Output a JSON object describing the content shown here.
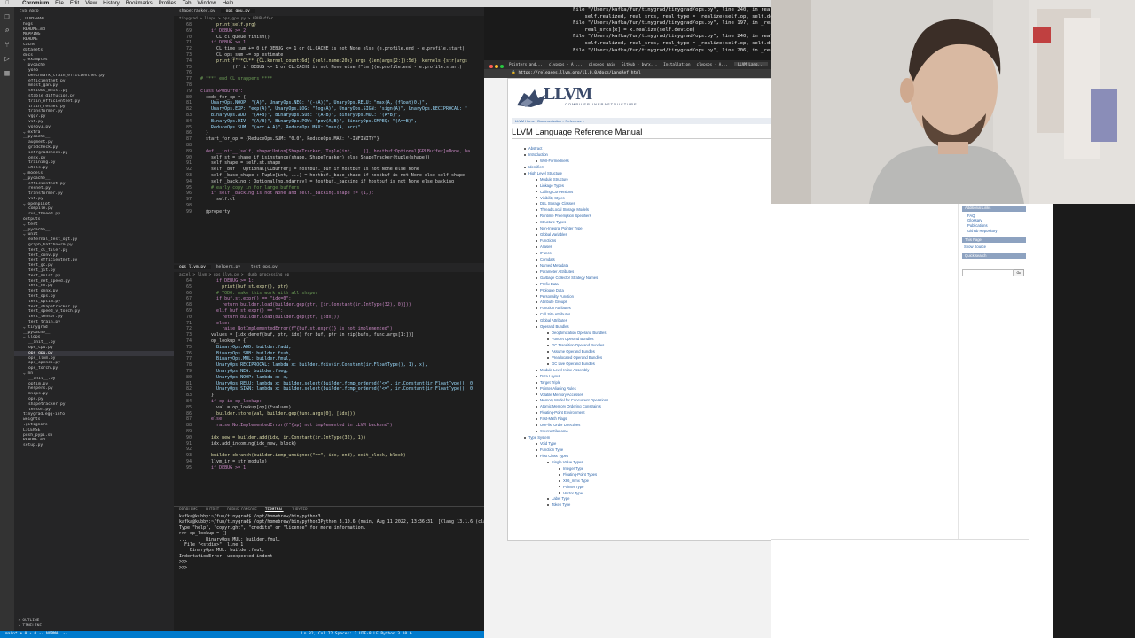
{
  "menubar": {
    "apple": "",
    "items": [
      "Chromium",
      "File",
      "Edit",
      "View",
      "History",
      "Bookmarks",
      "Profiles",
      "Tab",
      "Window",
      "Help"
    ],
    "clock": ""
  },
  "vscode": {
    "explorer_title": "EXPLORER",
    "tree": [
      "TINYGRAD",
      "hugs",
      "README.md",
      "MAPPING",
      "README",
      "cache",
      "datasets",
      "docs",
      "examples",
      "__pycache__",
      "yolo",
      "benchmark_train_efficientnet.py",
      "efficientnet.py",
      "mnist_gan.py",
      "serious_mnist.py",
      "stable_diffusion.py",
      "train_efficientnet.py",
      "train_resnet.py",
      "transformer.py",
      "vgg7.py",
      "vit.py",
      "yolov3.py",
      "extra",
      "__pycache__",
      "augment.py",
      "gradcheck.py",
      "intrgradcheck.py",
      "onnx.py",
      "training.py",
      "utils.py",
      "models",
      "__pycache__",
      "efficientnet.py",
      "resnet.py",
      "transformer.py",
      "vit.py",
      "openpilot",
      "compile.py",
      "run_thneed.py",
      "outputs",
      "test",
      "__pycache__",
      "unit",
      "external_test_opt.py",
      "graph_batchnorm.py",
      "test_cl_tiler.py",
      "test_conv.py",
      "test_efficientnet.py",
      "test_gc.py",
      "test_jit.py",
      "test_mnist.py",
      "test_net_speed.py",
      "test_nn.py",
      "test_onnx.py",
      "test_ops.py",
      "test_optim.py",
      "test_shapetracker.py",
      "test_speed_v_torch.py",
      "test_tensor.py",
      "test_train.py",
      "tinygrad",
      "__pycache__",
      "llops",
      "__init__.py",
      "ops_cpu.py",
      "ops_gpu.py",
      "ops_llvm.py",
      "ops_opencl.py",
      "ops_torch.py",
      "nn",
      "__init__.py",
      "optim.py",
      "helpers.py",
      "mlops.py",
      "ops.py",
      "shapetracker.py",
      "tensor.py",
      "tinygrad.egg-info",
      "weights",
      ".gitignore",
      "LICENSE",
      "push_pypi.sh",
      "README.md",
      "setup.py"
    ],
    "footer_items": [
      "OUTLINE",
      "TIMELINE"
    ],
    "editor1": {
      "tabs": [
        "shapetracker.py",
        "ops_gpu.py"
      ],
      "breadcrumb": "tinygrad > llops > ops_gpu.py > GPUBuffer",
      "first_line": 68,
      "lines": [
        "      print(self.prg)",
        "    if DEBUG >= 2:",
        "      CL.cl_queue.finish()",
        "    if DEBUG >= 1:",
        "      CL.time_sum += 0 if DEBUG <= 1 or CL.CACHE is not None else (e.profile.end - e.profile.start)",
        "      CL.ops_sum += op_estimate",
        "      print(f\"**CL** {CL.kernel_count:6d} {self.name:20s} args {len(args[2:]):5d}  kernels {str(args",
        "            (f\" if DEBUG <= 1 or CL.CACHE is not None else f\"tm {(e.profile.end - e.profile.start)",
        "",
        "# **** end CL wrappers ****",
        "",
        "class GPUBuffer:",
        "  code_for_op = {",
        "    UnaryOps.NOOP: \"(A)\", UnaryOps.NEG: \"(-(A))\", UnaryOps.RELU: \"max(A, (float)0.)\",",
        "    UnaryOps.EXP: \"exp(A)\", UnaryOps.LOG: \"log(A)\", UnaryOps.SIGN: \"sign(A)\", UnaryOps.RECIPROCAL: \"",
        "    BinaryOps.ADD: \"(A+B)\", BinaryOps.SUB: \"(A-B)\", BinaryOps.MUL: \"(A*B)\",",
        "    BinaryOps.DIV: \"(A/B)\", BinaryOps.POW: \"pow(A,B)\", BinaryOps.CMPEQ: \"(A==B)\",",
        "    ReduceOps.SUM: \"(acc + A)\", ReduceOps.MAX: \"max(A, acc)\"",
        "  }",
        "  start_for_op = {ReduceOps.SUM: \"0.0\", ReduceOps.MAX: \"-INFINITY\"}",
        "",
        "  def __init__(self, shape:Union[ShapeTracker, Tuple[int, ...]], hostbuf:Optional[GPUBuffer]=None, ba",
        "    self.st = shape if isinstance(shape, ShapeTracker) else ShapeTracker(tuple(shape))",
        "    self.shape = self.st.shape",
        "    self._buf : Optional[CLBuffer] = hostbuf._buf if hostbuf is not None else None",
        "    self._base_shape : Tuple[int, ...] = hostbuf._base_shape if hostbuf is not None else self.shape",
        "    self._backing : Optional[np.ndarray] = hostbuf._backing if hostbuf is not None else backing",
        "    # early copy in for large buffers",
        "    if self._backing is not None and self._backing.shape != (1,):",
        "      self.cl",
        "",
        "  @property"
      ]
    },
    "editor2": {
      "tabs": [
        "ops_llvm.py",
        "helpers.py",
        "test_ops.py"
      ],
      "breadcrumb": "accel > llvm > ops_llvm.py > _dumb_processing_op",
      "first_line": 64,
      "lines": [
        "      if DEBUG >= 1:",
        "        print(buf.st.expr(), ptr)",
        "      # TODO: make this work with all shapes",
        "      if buf.st.expr() == \"idx=0\":",
        "        return builder.load(builder.gep(ptr, [ir.Constant(ir.IntType(32), 0)]))",
        "      elif buf.st.expr() == \"\":",
        "        return builder.load(builder.gep(ptr, [idx]))",
        "      else:",
        "        raise NotImplementedError(f\"{buf.st.expr()} is not implemented\")",
        "    values = [idx_deref(buf, ptr, idx) for buf, ptr in zip(bufs, func.args[1:])]",
        "    op_lookup = {",
        "      BinaryOps.ADD: builder.fadd,",
        "      BinaryOps.SUB: builder.fsub,",
        "      BinaryOps.MUL: builder.fmul,",
        "      UnaryOps.RECIPROCAL: lambda x: builder.fdiv(ir.Constant(ir.FloatType(), 1), x),",
        "      UnaryOps.NEG: builder.fneg,",
        "      UnaryOps.NOOP: lambda x: x,",
        "      UnaryOps.RELU: lambda x: builder.select(builder.fcmp_ordered(\"<=\", ir.Constant(ir.FloatType(), 0",
        "      UnaryOps.SIGN: lambda x: builder.select(builder.fcmp_ordered(\"<=\", ir.Constant(ir.FloatType(), 0",
        "    }",
        "    if op in op_lookup:",
        "      val = op_lookup[op](*values)",
        "      builder.store(val, builder.gep(func.args[0], [idx]))",
        "    else:",
        "      raise NotImplementedError(f\"{op} not implemented in LLVM backend\")",
        "",
        "    idx_new = builder.add(idx, ir.Constant(ir.IntType(32), 1))",
        "    idx.add_incoming(idx_new, block)",
        "",
        "    builder.cbranch(builder.icmp_unsigned(\"==\", idx, end), exit_block, block)",
        "    llvm_ir = str(module)",
        "    if DEBUG >= 1:"
      ]
    },
    "terminal": {
      "panel_tabs": [
        "PROBLEMS",
        "OUTPUT",
        "DEBUG CONSOLE",
        "TERMINAL",
        "JUPYTER"
      ],
      "active_tab": "TERMINAL",
      "lines": [
        "kafka@kubby:~/fun/tinygrad$ /opt/homebrew/bin/python3",
        "kafka@kubby:~/fun/tinygrad$ /opt/homebrew/bin/python3Python 3.10.6 (main, Aug 11 2022, 13:36:31) [Clang 13.1.6 (clang-",
        "Type \"help\", \"copyright\", \"credits\" or \"license\" for more information.",
        ">>> op_lookup = {}",
        "...       BinaryOps.MUL: builder.fmul,",
        "  File \"<stdin>\", line 1",
        "    BinaryOps.MUL: builder.fmul,",
        "IndentationError: unexpected indent",
        ">>>",
        ">>>"
      ]
    },
    "status": {
      "left": "main*  ⊗ 0 ⚠ 0  -- NORMAL --",
      "right": "Ln 82, Col 72   Spaces: 2   UTF-8   LF   Python   3.10.6"
    }
  },
  "terminal_errors": [
    "File \"/Users/kafka/fun/tinygrad/tinygrad/ops.py\", line 240, in real",
    "    self.realized, real_srcs, real_type = _realize(self.op, self.device",
    "File \"/Users/kafka/fun/tinygrad/tinygrad/ops.py\", line 197, in _rea",
    "    real_srcs[x] = x.realize(self.device)",
    "File \"/Users/kafka/fun/tinygrad/tinygrad/ops.py\", line 240, in real",
    "    self.realized, real_srcs, real_type = _realize(self.op, self.devi",
    "File \"/Users/kafka/fun/tinygrad/tinygrad/ops.py\", line 206, in _rea"
  ],
  "browser": {
    "tabs": [
      "Pointers and...",
      "clypsos - A ...",
      "clypsos_main",
      "GitHub - byrx...",
      "Installation",
      "clypsos - A...",
      "LLVM Lang..."
    ],
    "url": "https://releases.llvm.org/11.0.0/docs/LangRef.html",
    "logo_text": "LLVM",
    "logo_sub": "COMPILER INFRASTRUCTURE",
    "nav": "LLVM Home  |  Documentation » Reference »",
    "doc_title": "LLVM Language Reference Manual",
    "toc": [
      {
        "t": "Abstract",
        "l": 0
      },
      {
        "t": "Introduction",
        "l": 0
      },
      {
        "t": "Well-Formedness",
        "l": 1
      },
      {
        "t": "Identifiers",
        "l": 0
      },
      {
        "t": "High Level Structure",
        "l": 0
      },
      {
        "t": "Module Structure",
        "l": 1
      },
      {
        "t": "Linkage Types",
        "l": 1
      },
      {
        "t": "Calling Conventions",
        "l": 1
      },
      {
        "t": "Visibility Styles",
        "l": 1
      },
      {
        "t": "DLL Storage Classes",
        "l": 1
      },
      {
        "t": "Thread Local Storage Models",
        "l": 1
      },
      {
        "t": "Runtime Preemption Specifiers",
        "l": 1
      },
      {
        "t": "Structure Types",
        "l": 1
      },
      {
        "t": "Non-Integral Pointer Type",
        "l": 1
      },
      {
        "t": "Global Variables",
        "l": 1
      },
      {
        "t": "Functions",
        "l": 1
      },
      {
        "t": "Aliases",
        "l": 1
      },
      {
        "t": "IFuncs",
        "l": 1
      },
      {
        "t": "Comdats",
        "l": 1
      },
      {
        "t": "Named Metadata",
        "l": 1
      },
      {
        "t": "Parameter Attributes",
        "l": 1
      },
      {
        "t": "Garbage Collector Strategy Names",
        "l": 1
      },
      {
        "t": "Prefix Data",
        "l": 1
      },
      {
        "t": "Prologue Data",
        "l": 1
      },
      {
        "t": "Personality Function",
        "l": 1
      },
      {
        "t": "Attribute Groups",
        "l": 1
      },
      {
        "t": "Function Attributes",
        "l": 1
      },
      {
        "t": "Call Site Attributes",
        "l": 1
      },
      {
        "t": "Global Attributes",
        "l": 1
      },
      {
        "t": "Operand Bundles",
        "l": 1
      },
      {
        "t": "Deoptimization Operand Bundles",
        "l": 2
      },
      {
        "t": "Funclet Operand Bundles",
        "l": 2
      },
      {
        "t": "GC Transition Operand Bundles",
        "l": 2
      },
      {
        "t": "Assume Operand Bundles",
        "l": 2
      },
      {
        "t": "Preallocated Operand Bundles",
        "l": 2
      },
      {
        "t": "GC Live Operand Bundles",
        "l": 2
      },
      {
        "t": "Module-Level Inline Assembly",
        "l": 1
      },
      {
        "t": "Data Layout",
        "l": 1
      },
      {
        "t": "Target Triple",
        "l": 1
      },
      {
        "t": "Pointer Aliasing Rules",
        "l": 1
      },
      {
        "t": "Volatile Memory Accesses",
        "l": 1
      },
      {
        "t": "Memory Model for Concurrent Operations",
        "l": 1
      },
      {
        "t": "Atomic Memory Ordering Constraints",
        "l": 1
      },
      {
        "t": "Floating-Point Environment",
        "l": 1
      },
      {
        "t": "Fast-Math Flags",
        "l": 1
      },
      {
        "t": "Use-list Order Directives",
        "l": 1
      },
      {
        "t": "Source Filename",
        "l": 1
      },
      {
        "t": "Type System",
        "l": 0
      },
      {
        "t": "Void Type",
        "l": 1
      },
      {
        "t": "Function Type",
        "l": 1
      },
      {
        "t": "First Class Types",
        "l": 1
      },
      {
        "t": "Single Value Types",
        "l": 2
      },
      {
        "t": "Integer Type",
        "l": 3
      },
      {
        "t": "Floating-Point Types",
        "l": 3
      },
      {
        "t": "X86_mmx Type",
        "l": 3
      },
      {
        "t": "Pointer Type",
        "l": 3
      },
      {
        "t": "Vector Type",
        "l": 3
      },
      {
        "t": "Label Type",
        "l": 2
      },
      {
        "t": "Token Type",
        "l": 2
      }
    ],
    "sidebar": {
      "additional_links_title": "Additional Links",
      "additional_links": [
        "FAQ",
        "Glossary",
        "Publications",
        "Github Repository"
      ],
      "this_page_title": "This Page",
      "this_page_links": [
        "Show Source"
      ],
      "quick_search_title": "Quick search",
      "go_label": "Go"
    }
  },
  "colors": {
    "link": "#2a62a8",
    "vscode_bg": "#1e1e1e",
    "statusbar": "#007acc",
    "sidebar_header": "#8da2c0"
  }
}
